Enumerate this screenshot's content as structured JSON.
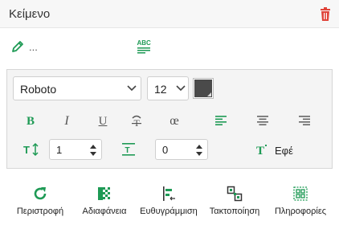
{
  "header": {
    "title": "Κείμενο",
    "delete_icon": "trash-icon"
  },
  "edit_row": {
    "pen_icon": "pencil-icon",
    "text": "...",
    "spellcheck_icon": "abc-spellcheck-icon"
  },
  "font": {
    "family": "Roboto",
    "size": "12",
    "color": "#4a4a4a"
  },
  "format_buttons": [
    {
      "label": "B",
      "name": "bold-button"
    },
    {
      "label": "I",
      "name": "italic-button"
    },
    {
      "label": "U",
      "name": "underline-button"
    },
    {
      "label": "œ",
      "name": "ligature-button"
    }
  ],
  "spacing": {
    "line_height_value": "1",
    "letter_spacing_value": "0"
  },
  "effects": {
    "label": "Εφέ"
  },
  "toolbar": [
    {
      "label": "Περιστροφή",
      "icon": "rotate-icon"
    },
    {
      "label": "Αδιαφάνεια",
      "icon": "opacity-icon"
    },
    {
      "label": "Ευθυγράμμιση",
      "icon": "align-icon"
    },
    {
      "label": "Τακτοποίηση",
      "icon": "arrange-icon"
    },
    {
      "label": "Πληροφορίες",
      "icon": "info-icon"
    }
  ],
  "colors": {
    "accent": "#1e9a55",
    "delete": "#e0443a"
  }
}
